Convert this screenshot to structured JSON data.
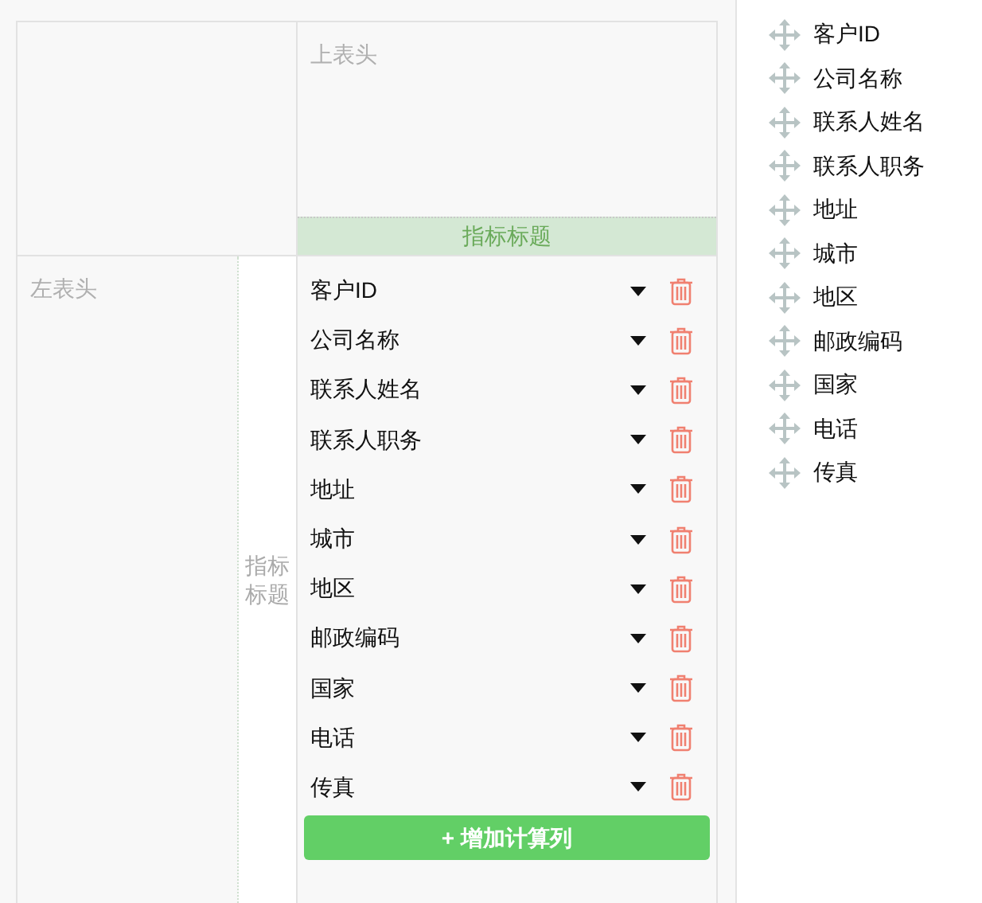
{
  "top_header": {
    "placeholder": "上表头",
    "metric_title": "指标标题"
  },
  "left_header": {
    "placeholder": "左表头",
    "metric_title": "指标标题"
  },
  "metrics": [
    {
      "label": "客户ID"
    },
    {
      "label": "公司名称"
    },
    {
      "label": "联系人姓名"
    },
    {
      "label": "联系人职务"
    },
    {
      "label": "地址"
    },
    {
      "label": "城市"
    },
    {
      "label": "地区"
    },
    {
      "label": "邮政编码"
    },
    {
      "label": "国家"
    },
    {
      "label": "电话"
    },
    {
      "label": "传真"
    }
  ],
  "add_button": {
    "icon": "+",
    "label": "增加计算列"
  },
  "fields": [
    {
      "label": "客户ID"
    },
    {
      "label": "公司名称"
    },
    {
      "label": "联系人姓名"
    },
    {
      "label": "联系人职务"
    },
    {
      "label": "地址"
    },
    {
      "label": "城市"
    },
    {
      "label": "地区"
    },
    {
      "label": "邮政编码"
    },
    {
      "label": "国家"
    },
    {
      "label": "电话"
    },
    {
      "label": "传真"
    }
  ]
}
